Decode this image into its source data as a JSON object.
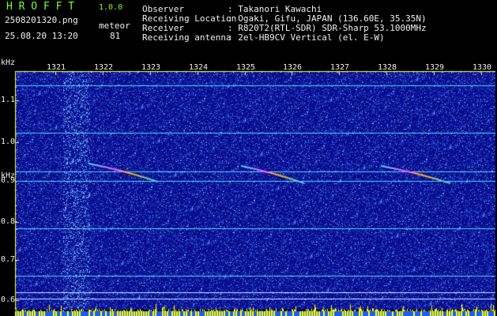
{
  "app": {
    "name": "H R O F F T",
    "version": "1.0.0"
  },
  "file": {
    "name": "2508201320.png",
    "datetime": "25.08.20 13:20"
  },
  "meteor": {
    "label": "meteor",
    "count": "81"
  },
  "info": {
    "rows": [
      {
        "label": "Observer",
        "value": ": Takanori Kawachi"
      },
      {
        "label": "Receiving Location",
        "value": ": Ogaki, Gifu, JAPAN (136.60E, 35.35N)"
      },
      {
        "label": "Receiver",
        "value": ": R820T2(RTL-SDR) SDR-Sharp 53.1000MHz"
      },
      {
        "label": "Receiving antenna",
        "value": ": 2el-HB9CV Vertical (el. E-W)"
      }
    ]
  },
  "axes": {
    "y_unit_top": "kHz",
    "y_unit_bottom": "kHz",
    "x_ticks": [
      "1321",
      "1322",
      "1323",
      "1324",
      "1325",
      "1326",
      "1327",
      "1328",
      "1329",
      "1330"
    ],
    "y_ticks": [
      "1.1",
      "1.0",
      "0.9",
      "0.8",
      "0.7",
      "0.6"
    ]
  },
  "colors": {
    "header_green": "#7cff2e",
    "axis_yellow": "#ffff33",
    "background_blue": "#0a0a8c",
    "signal_line": "#4ed6ff",
    "noise_bar_yellow": "#ffff00",
    "noise_bar_blue": "#1a5cff",
    "echo_magenta": "#ff55ff"
  }
}
